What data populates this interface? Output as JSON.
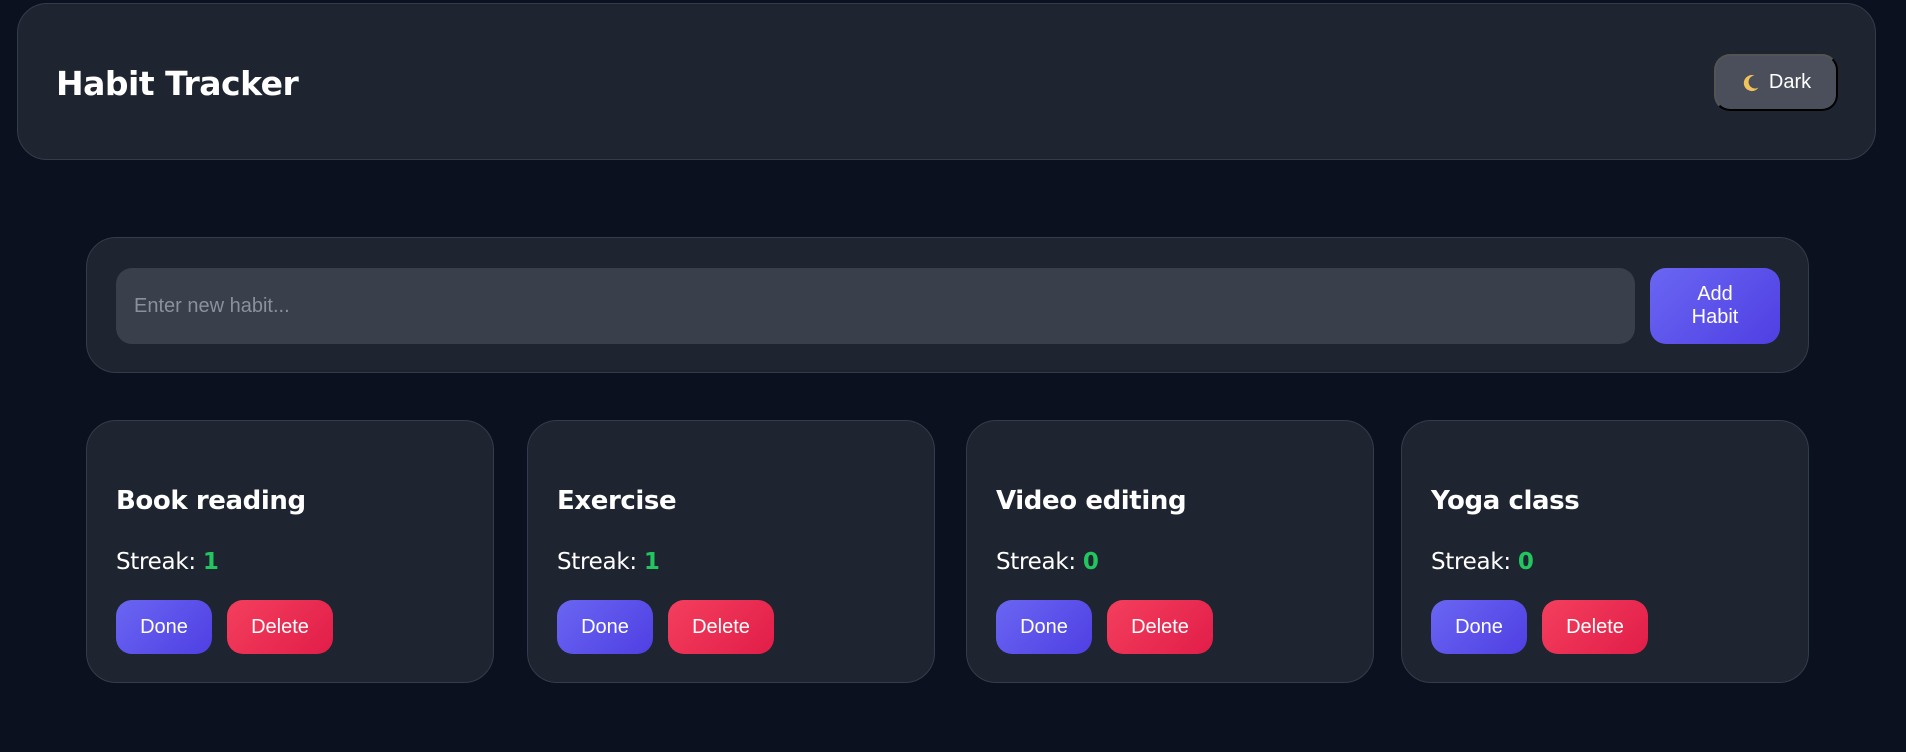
{
  "header": {
    "title": "Habit Tracker",
    "theme_toggle": {
      "icon": "moon-icon",
      "label": "Dark"
    }
  },
  "add_habit": {
    "placeholder": "Enter new habit...",
    "value": "",
    "button_label": "Add Habit"
  },
  "habits": [
    {
      "name": "Book reading",
      "streak_label": "Streak:",
      "streak": "1",
      "done_label": "Done",
      "delete_label": "Delete"
    },
    {
      "name": "Exercise",
      "streak_label": "Streak:",
      "streak": "1",
      "done_label": "Done",
      "delete_label": "Delete"
    },
    {
      "name": "Video editing",
      "streak_label": "Streak:",
      "streak": "0",
      "done_label": "Done",
      "delete_label": "Delete"
    },
    {
      "name": "Yoga class",
      "streak_label": "Streak:",
      "streak": "0",
      "done_label": "Done",
      "delete_label": "Delete"
    }
  ],
  "colors": {
    "background": "#0b111f",
    "panel": "#1f2431",
    "accent": "#5b52ec",
    "danger": "#ec2c52",
    "streak": "#22c55e"
  }
}
